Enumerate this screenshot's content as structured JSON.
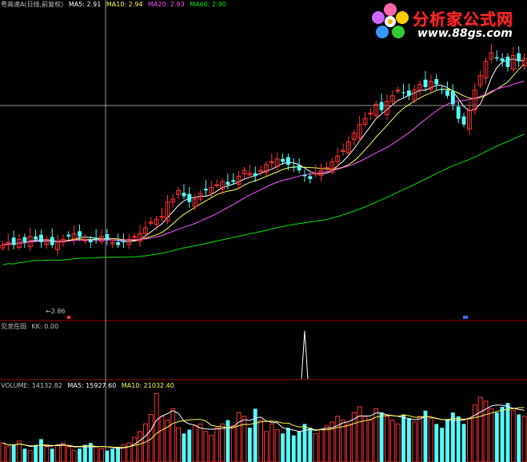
{
  "colors": {
    "up": "#ff3232",
    "down": "#54fcfc",
    "ma5": "#ffffff",
    "ma10": "#ffff54",
    "ma20": "#ff54ff",
    "ma60": "#00e600",
    "separator": "#a00000",
    "crosshair": "#9a9a9a"
  },
  "price_panel": {
    "stock": "粤高速A",
    "period": "(日线,前复权)",
    "ma5_label": "MA5: 2.91",
    "ma10_label": "MA10: 2.94",
    "ma20_label": "MA20: 2.93",
    "ma60_label": "MA60: 2.90",
    "low_marker": "←2.86"
  },
  "indicator_panel": {
    "title": "见龙在田",
    "kk_label": "KK: 0.00"
  },
  "volume_panel": {
    "vol_label": "VOLUME: 14132.82",
    "ma5_label": "MA5: 15927.60",
    "ma10_label": "MA10: 21032.40"
  },
  "logo": {
    "title": "分析家公式网",
    "url": "www.88gs.com"
  },
  "chart_data": {
    "type": "candlestick",
    "title": "",
    "price_range": [
      2.6,
      3.68
    ],
    "candles_count": 96,
    "closes": [
      2.86,
      2.87,
      2.86,
      2.88,
      2.87,
      2.89,
      2.88,
      2.87,
      2.88,
      2.86,
      2.87,
      2.88,
      2.89,
      2.9,
      2.89,
      2.88,
      2.87,
      2.88,
      2.89,
      2.88,
      2.87,
      2.86,
      2.87,
      2.88,
      2.89,
      2.9,
      2.92,
      2.94,
      2.95,
      2.96,
      3.01,
      3.02,
      3.05,
      3.03,
      3.01,
      3.02,
      3.04,
      3.05,
      3.06,
      3.07,
      3.08,
      3.07,
      3.08,
      3.1,
      3.12,
      3.11,
      3.1,
      3.12,
      3.14,
      3.15,
      3.16,
      3.15,
      3.14,
      3.13,
      3.12,
      3.1,
      3.09,
      3.11,
      3.12,
      3.13,
      3.15,
      3.17,
      3.19,
      3.22,
      3.25,
      3.28,
      3.3,
      3.32,
      3.35,
      3.33,
      3.36,
      3.38,
      3.4,
      3.39,
      3.38,
      3.4,
      3.42,
      3.41,
      3.43,
      3.42,
      3.4,
      3.38,
      3.35,
      3.3,
      3.28,
      3.33,
      3.4,
      3.45,
      3.5,
      3.53,
      3.51,
      3.5,
      3.48,
      3.52,
      3.5,
      3.51
    ],
    "kk_peak_index": 55,
    "volumes": [
      1.0,
      0.8,
      0.9,
      1.1,
      0.7,
      0.6,
      0.9,
      1.2,
      0.8,
      0.7,
      0.9,
      1.0,
      0.8,
      0.6,
      0.7,
      0.9,
      1.0,
      0.8,
      0.7,
      0.6,
      0.7,
      0.8,
      0.9,
      1.0,
      1.3,
      1.6,
      2.0,
      2.5,
      3.6,
      2.4,
      2.2,
      2.8,
      1.8,
      1.5,
      1.7,
      1.9,
      2.0,
      1.6,
      1.4,
      1.8,
      2.0,
      2.2,
      1.9,
      2.6,
      2.4,
      1.8,
      2.8,
      2.2,
      1.6,
      2.0,
      1.7,
      1.5,
      1.8,
      1.4,
      1.6,
      2.0,
      1.8,
      1.5,
      1.7,
      1.9,
      2.1,
      2.4,
      2.2,
      2.0,
      2.6,
      2.9,
      2.4,
      2.2,
      2.8,
      2.6,
      2.4,
      2.2,
      2.0,
      2.5,
      2.3,
      2.1,
      2.4,
      2.7,
      2.3,
      2.0,
      1.8,
      2.2,
      2.6,
      2.4,
      2.0,
      2.3,
      3.0,
      3.4,
      3.2,
      2.8,
      2.6,
      2.9,
      3.1,
      2.7,
      2.5,
      2.4
    ]
  }
}
